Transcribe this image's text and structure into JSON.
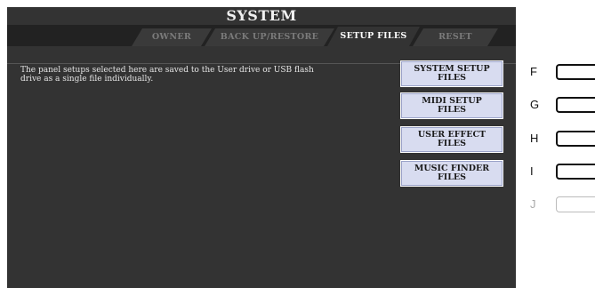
{
  "screen": {
    "title": "SYSTEM",
    "tabs": [
      {
        "label": "OWNER",
        "active": false
      },
      {
        "label": "BACK UP/RESTORE",
        "active": false
      },
      {
        "label": "SETUP FILES",
        "active": true
      },
      {
        "label": "RESET",
        "active": false
      }
    ],
    "description": "The panel setups selected here are saved to the User drive or USB flash drive as a single file individually.",
    "buttons": [
      {
        "line1": "SYSTEM SETUP",
        "line2": "FILES"
      },
      {
        "line1": "MIDI SETUP",
        "line2": "FILES"
      },
      {
        "line1": "USER EFFECT",
        "line2": "FILES"
      },
      {
        "line1": "MUSIC FINDER",
        "line2": "FILES"
      }
    ]
  },
  "panel_buttons": [
    {
      "label": "F",
      "enabled": true
    },
    {
      "label": "G",
      "enabled": true
    },
    {
      "label": "H",
      "enabled": true
    },
    {
      "label": "I",
      "enabled": true
    },
    {
      "label": "J",
      "enabled": false
    }
  ],
  "colors": {
    "screen_bg": "#333333",
    "button_bg": "#d8dcf0",
    "active_tab_text": "#ffffff",
    "inactive_tab_text": "#7b7b7b"
  }
}
